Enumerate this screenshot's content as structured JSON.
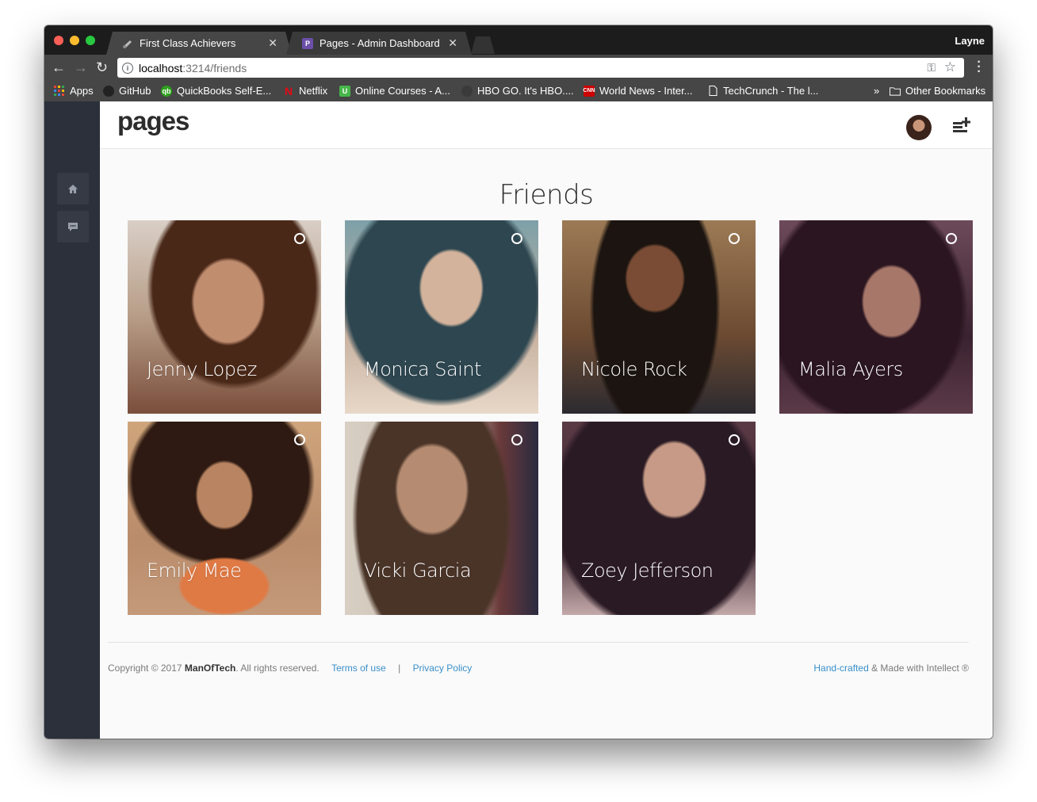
{
  "browser": {
    "tabs": [
      {
        "title": "First Class Achievers",
        "close": "✕"
      },
      {
        "title": "Pages - Admin Dashboard UI K",
        "favicon_letter": "P",
        "close": "✕"
      }
    ],
    "profile_name": "Layne",
    "url_host": "localhost",
    "url_path": ":3214/friends",
    "bookmarks": [
      {
        "label": "Apps"
      },
      {
        "label": "GitHub"
      },
      {
        "label": "QuickBooks Self-E..."
      },
      {
        "label": "Netflix"
      },
      {
        "label": "Online Courses - A..."
      },
      {
        "label": "HBO GO. It's HBO...."
      },
      {
        "label": "World News - Inter..."
      },
      {
        "label": "TechCrunch - The l..."
      }
    ],
    "overflow": "»",
    "other_bookmarks": "Other Bookmarks"
  },
  "app": {
    "logo": "pages",
    "page_title": "Friends",
    "friends": [
      {
        "name": "Jenny Lopez"
      },
      {
        "name": "Monica Saint"
      },
      {
        "name": "Nicole Rock"
      },
      {
        "name": "Malia Ayers"
      },
      {
        "name": "Emily Mae"
      },
      {
        "name": "Vicki Garcia"
      },
      {
        "name": "Zoey Jefferson"
      }
    ],
    "footer": {
      "copyright": "Copyright © 2017",
      "brand": "ManOfTech",
      "rights": ". All rights reserved.",
      "terms": "Terms of use",
      "divider": "|",
      "privacy": "Privacy Policy",
      "handcrafted": "Hand-crafted",
      "made_with": "& Made with Intellect ®"
    }
  },
  "colors": {
    "sidebar": "#2b303b",
    "link": "#3a8fc9",
    "browser_chrome": "#464646"
  }
}
